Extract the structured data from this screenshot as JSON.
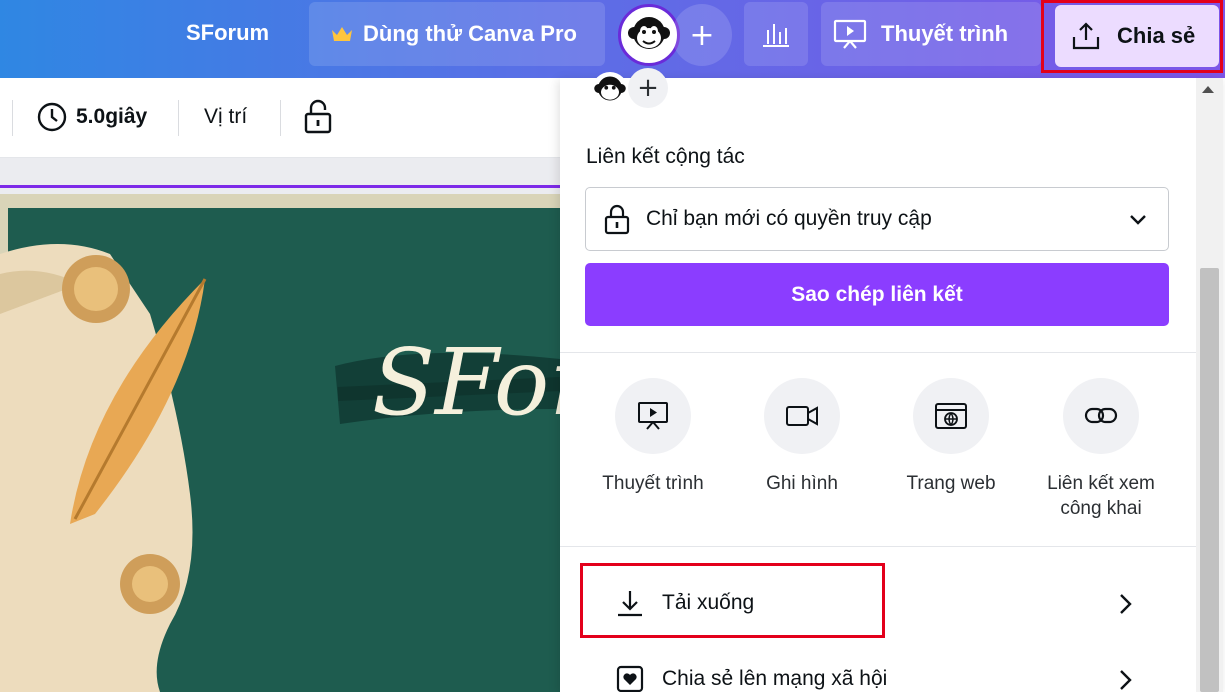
{
  "topbar": {
    "title": "SForum",
    "pro_label": "Dùng thử Canva Pro",
    "plus": "+",
    "present_label": "Thuyết trình",
    "share_label": "Chia sẻ"
  },
  "toolbar": {
    "duration": "5.0giây",
    "position_label": "Vị trí"
  },
  "canvas": {
    "title_text": "SForu"
  },
  "share_panel": {
    "mini_plus": "+",
    "collab_title": "Liên kết cộng tác",
    "access_value": "Chỉ bạn mới có quyền truy cập",
    "copy_button": "Sao chép liên kết",
    "options": [
      {
        "label": "Thuyết trình",
        "icon": "presentation-icon"
      },
      {
        "label": "Ghi hình",
        "icon": "video-camera-icon"
      },
      {
        "label": "Trang web",
        "icon": "website-icon"
      },
      {
        "label": "Liên kết xem công khai",
        "icon": "link-icon"
      }
    ],
    "rows": [
      {
        "label": "Tải xuống",
        "icon": "download-icon"
      },
      {
        "label": "Chia sẻ lên mạng xã hội",
        "icon": "social-heart-icon"
      }
    ]
  },
  "colors": {
    "accent": "#8b3dff",
    "highlight": "#e3001b",
    "canvas_green": "#1e5c4f"
  }
}
